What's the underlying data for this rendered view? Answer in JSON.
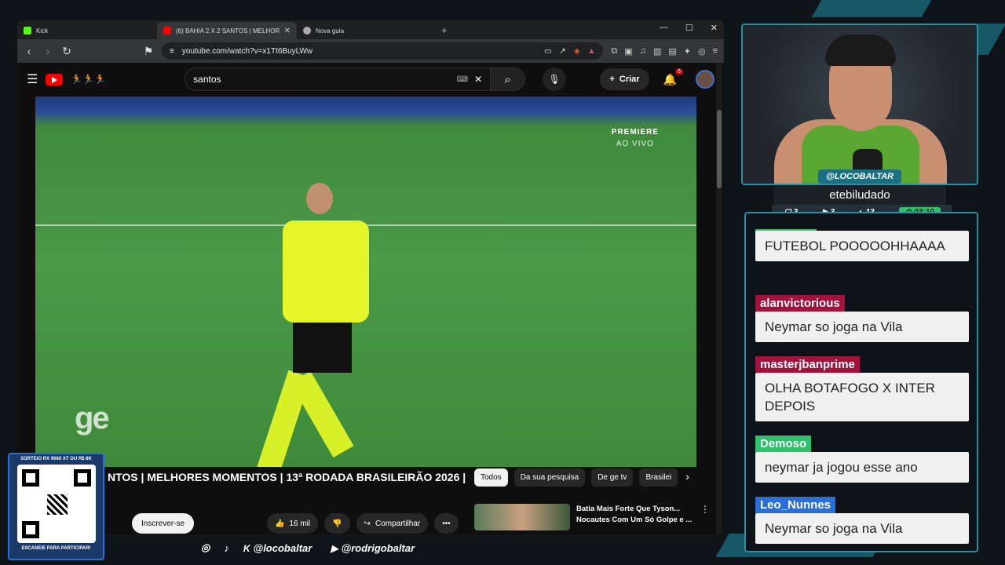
{
  "browser": {
    "tabs": [
      {
        "label": "Kick",
        "fav_color": "#53fc18",
        "active": false
      },
      {
        "label": "(6) BAHIA 2 X 2 SANTOS | MELHORE",
        "fav_color": "#ff0000",
        "active": true
      },
      {
        "label": "Nova guia",
        "fav_color": "#aaaaaa",
        "active": false
      }
    ],
    "url": "youtube.com/watch?v=x1Tt6BuyLWw"
  },
  "youtube": {
    "search_query": "santos",
    "create_label": "Criar",
    "notif_count": "6",
    "video_overlay": {
      "premiere": "PREMIERE",
      "live": "AO VIVO",
      "watermark": "ge"
    },
    "video_title": "NTOS | MELHORES MOMENTOS | 13ª RODADA BRASILEIRÃO 2026 |",
    "subscribe_label": "Inscrever-se",
    "likes": "16 mil",
    "share_label": "Compartilhar",
    "chips": [
      "Todos",
      "Da sua pesquisa",
      "De ge tv",
      "Brasilei"
    ],
    "rec_title": "Batia Mais Forte Que Tyson... Nocautes Com Um Só Golpe e ..."
  },
  "stream": {
    "handle": "@LOCOBALTAR",
    "name": "etebiludado",
    "stats": [
      "3",
      "3",
      "13"
    ],
    "timer": "03:10",
    "chat": [
      {
        "user": "",
        "text": "FUTEBOL POOOOOHHAAAA",
        "color": "#2ec26a"
      },
      {
        "user": "alanvictorious",
        "text": "Neymar so joga na Vila",
        "color": "#a3123a"
      },
      {
        "user": "masterjbanprime",
        "text": "OLHA BOTAFOGO X INTER DEPOIS",
        "color": "#a3123a"
      },
      {
        "user": "Demoso",
        "text": "neymar ja jogou esse ano",
        "color": "#2ec26a"
      },
      {
        "user": "Leo_Nunnes",
        "text": "Neymar so joga na Vila",
        "color": "#2a6fd8"
      }
    ],
    "qr": {
      "top": "SORTEIO RX 9060 XT OU R$ 8K",
      "bottom": "ESCANEIE PARA PARTICIPAR!"
    },
    "socials": [
      "@locobaltar",
      "@rodrigobaltar"
    ]
  }
}
